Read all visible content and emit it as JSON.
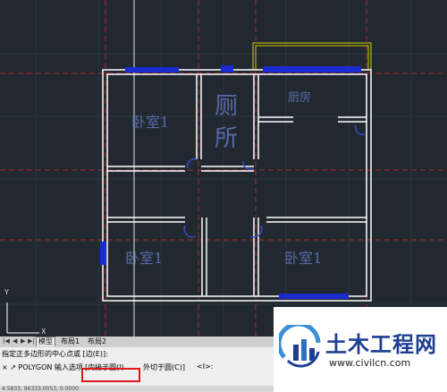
{
  "rooms": {
    "bedroom_top": "卧室1",
    "toilet_top": "厕",
    "toilet_bottom": "所",
    "kitchen": "厨房",
    "bedroom_bottom_left": "卧室1",
    "bedroom_bottom_right": "卧室1"
  },
  "ucs": {
    "x_label": "X",
    "y_label": "Y"
  },
  "tabs": {
    "model": "模型",
    "layout1": "布局1",
    "layout2": "布局2"
  },
  "command": {
    "history": "指定正多边形的中心点或 [边(E)]:",
    "prompt_prefix": "POLYGON 输入选项",
    "option_inscribed": "[内接于圆(I)",
    "option_circumscribed": "外切于圆(C)]",
    "default_value": "<I>:",
    "coords": "4.5833, 96333.0053, 0.0000"
  },
  "watermark": {
    "title": "土木工程网",
    "url": "www.civilcn.com"
  },
  "colors": {
    "background": "#212830",
    "wall": "#ffffff",
    "window": "#1c2bd0",
    "highlight": "#e0191d",
    "logo_blue": "#1e3f92"
  }
}
